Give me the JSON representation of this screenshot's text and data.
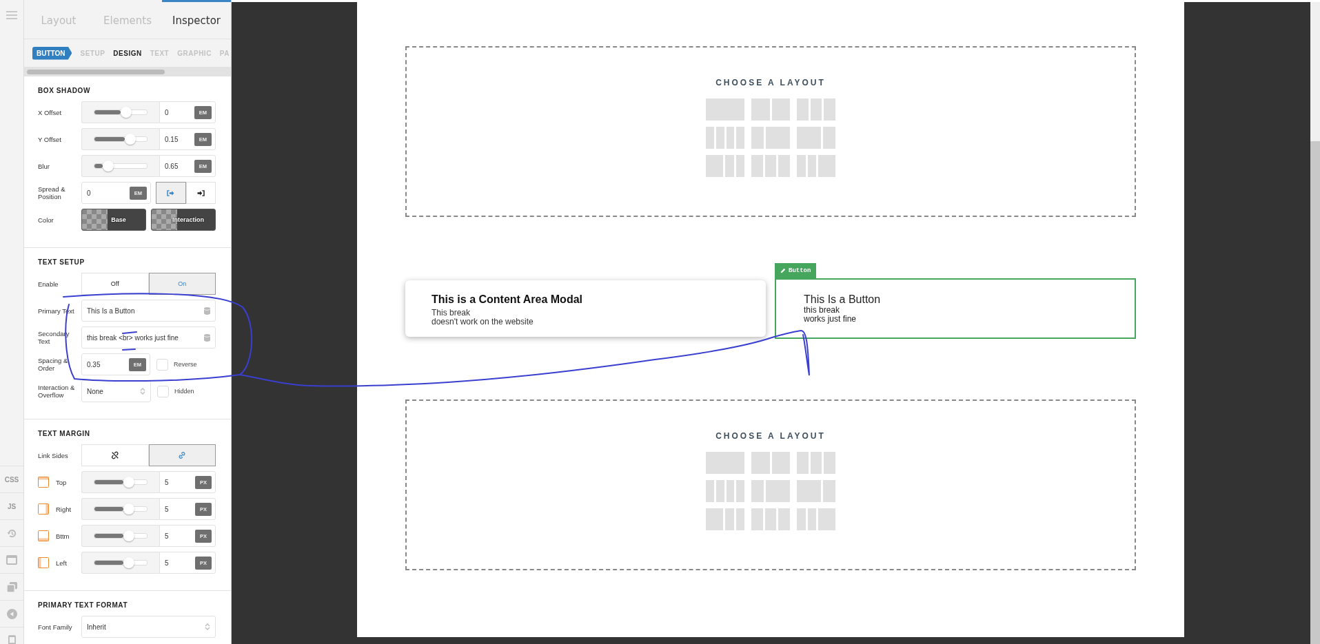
{
  "rail": {
    "labels": [
      "CSS",
      "JS"
    ]
  },
  "panel_tabs": [
    {
      "label": "Layout",
      "selected": false
    },
    {
      "label": "Elements",
      "selected": false
    },
    {
      "label": "Inspector",
      "selected": true
    }
  ],
  "breadcrumb": "BUTTON",
  "sub_tabs": [
    {
      "label": "SETUP",
      "selected": false
    },
    {
      "label": "DESIGN",
      "selected": true
    },
    {
      "label": "TEXT",
      "selected": false
    },
    {
      "label": "GRAPHIC",
      "selected": false
    },
    {
      "label": "PA",
      "selected": false
    }
  ],
  "sections": [
    {
      "title": "BOX SHADOW",
      "rows": [
        {
          "kind": "slider",
          "label": "X Offset",
          "level": 0.5,
          "value": "0",
          "unit": "EM"
        },
        {
          "kind": "slider",
          "label": "Y Offset",
          "level": 0.58,
          "value": "0.15",
          "unit": "EM"
        },
        {
          "kind": "slider",
          "label": "Blur",
          "level": 0.16,
          "value": "0.65",
          "unit": "EM"
        },
        {
          "kind": "unit-toggle",
          "label": "Spread & Position",
          "value": "0",
          "unit": "EM",
          "options": [
            {
              "selected": true
            },
            {
              "selected": false
            }
          ]
        },
        {
          "kind": "swatches",
          "label": "Color",
          "options": [
            "Base",
            "Interaction"
          ]
        }
      ]
    },
    {
      "title": "TEXT SETUP",
      "rows": [
        {
          "kind": "segmented",
          "label": "Enable",
          "options": [
            {
              "label": "Off",
              "selected": false
            },
            {
              "label": "On",
              "selected": true
            }
          ]
        },
        {
          "kind": "text",
          "label": "Primary Text",
          "value": "This Is a Button"
        },
        {
          "kind": "text",
          "label": "Secondary Text",
          "value": "this break <br> works just fine"
        },
        {
          "kind": "unit-check",
          "label": "Spacing & Order",
          "value": "0.35",
          "unit": "EM",
          "check_label": "Reverse",
          "checked": false
        },
        {
          "kind": "select-check",
          "label": "Interaction & Overflow",
          "value": "None",
          "check_label": "Hidden",
          "checked": false
        }
      ]
    },
    {
      "title": "TEXT MARGIN",
      "rows": [
        {
          "kind": "link-toggle",
          "label": "Link Sides",
          "options": [
            {
              "selected": false
            },
            {
              "selected": true
            }
          ]
        },
        {
          "kind": "slider-top",
          "label": "Top",
          "level": 0.55,
          "value": "5",
          "unit": "PX"
        },
        {
          "kind": "slider-right",
          "label": "Right",
          "level": 0.55,
          "value": "5",
          "unit": "PX"
        },
        {
          "kind": "slider-bottom",
          "label": "Bttm",
          "level": 0.55,
          "value": "5",
          "unit": "PX"
        },
        {
          "kind": "slider-left",
          "label": "Left",
          "level": 0.55,
          "value": "5",
          "unit": "PX"
        }
      ]
    },
    {
      "title": "PRIMARY TEXT FORMAT",
      "rows": [
        {
          "kind": "select",
          "label": "Font Family",
          "value": "Inherit"
        }
      ]
    }
  ],
  "blocks": [
    {
      "kind": "layout",
      "title": "CHOOSE A LAYOUT"
    },
    {
      "kind": "row",
      "modal": {
        "title": "This is a Content Area Modal",
        "lines": [
          "This break",
          "doesn't work on the website"
        ]
      },
      "button": {
        "tag": "Button",
        "primary": "This Is a Button",
        "lines": [
          "this break",
          "works just fine"
        ]
      }
    },
    {
      "kind": "layout",
      "title": "CHOOSE A LAYOUT"
    }
  ]
}
